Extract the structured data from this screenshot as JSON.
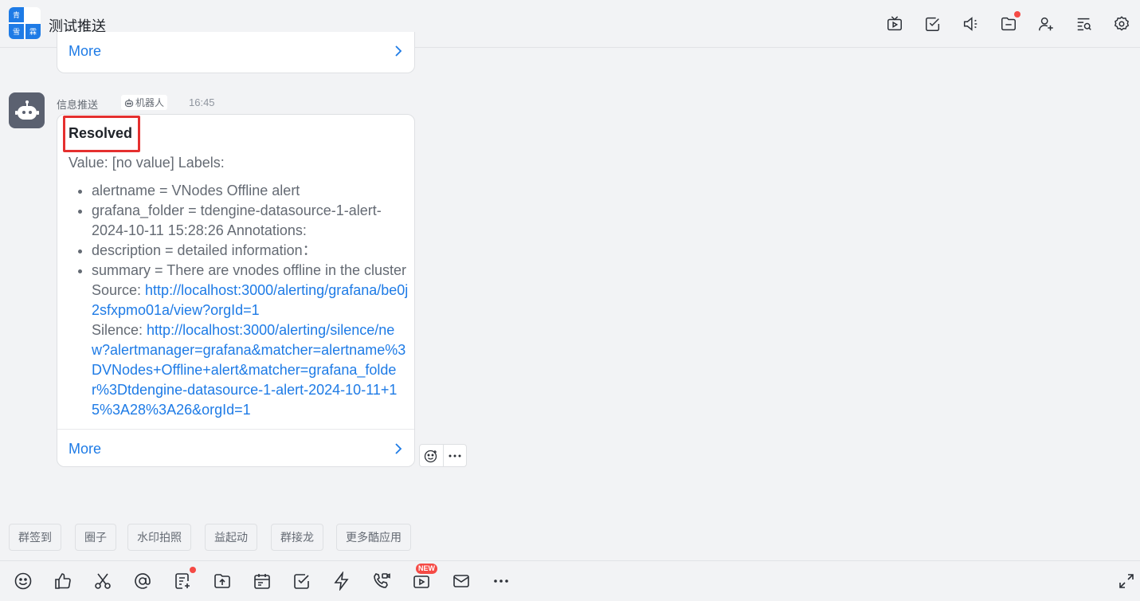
{
  "header": {
    "logo_chars": [
      "青",
      "",
      "雪",
      "霖"
    ],
    "title": "测试推送"
  },
  "prev_message": {
    "more_label": "More"
  },
  "message": {
    "sender": "信息推送",
    "bot_tag": "机器人",
    "time": "16:45",
    "title": "Resolved",
    "intro": "Value: [no value] Labels:",
    "items": [
      "alertname = VNodes Offline alert",
      "grafana_folder = tdengine-datasource-1-alert-2024-10-11 15:28:26 Annotations:",
      "description = detailed information："
    ],
    "summary_prefix": "summary = There are vnodes offline in the cluster Source: ",
    "source_link": "http://localhost:3000/alerting/grafana/be0j2sfxpmo01a/view?orgId=1",
    "silence_prefix": "Silence: ",
    "silence_link": "http://localhost:3000/alerting/silence/new?alertmanager=grafana&matcher=alertname%3DVNodes+Offline+alert&matcher=grafana_folder%3Dtdengine-datasource-1-alert-2024-10-11+15%3A28%3A26&orgId=1",
    "more_label": "More"
  },
  "apps": [
    "群签到",
    "圈子",
    "水印拍照",
    "益起动",
    "群接龙",
    "更多酷应用"
  ],
  "toolbar": {
    "new_badge": "NEW"
  },
  "colors": {
    "accent": "#1e7be6",
    "highlight_border": "#e5302f",
    "notification_dot": "#f54a45"
  }
}
